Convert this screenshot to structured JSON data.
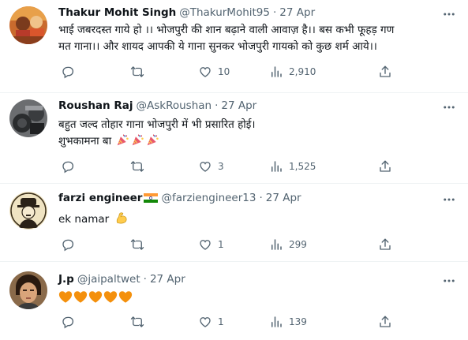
{
  "tweets": [
    {
      "name": "Thakur Mohit Singh",
      "handle": "@ThakurMohit95",
      "separator": "·",
      "time": "27 Apr",
      "text_lines": [
        "भाई जबरदस्त गाये हो ।। भोजपुरी की शान बढ़ाने वाली आवाज़ है।। बस कभी फूहड़ गण",
        "मत गाना।। और शायद आपकी ये गाना सुनकर भोजपुरी गायको को कुछ शर्म आये।।"
      ],
      "replies": "",
      "retweets": "",
      "likes": "10",
      "views": "2,910"
    },
    {
      "name": "Roushan Raj",
      "handle": "@AskRoushan",
      "separator": "·",
      "time": "27 Apr",
      "text_lines": [
        "बहुत जल्द तोहार गाना भोजपुरी में भी प्रसारित होई।",
        "शुभकामना बा"
      ],
      "emoji_icons": [
        "party-popper-icon",
        "party-popper-icon",
        "party-popper-icon"
      ],
      "replies": "",
      "retweets": "",
      "likes": "3",
      "views": "1,525"
    },
    {
      "name": "farzi engineer",
      "flag_icon": "india-flag-icon",
      "handle": "@farziengineer13",
      "separator": "·",
      "time": "27 Apr",
      "text_lines": [
        "ek namar"
      ],
      "emoji_icons": [
        "flexed-biceps-icon"
      ],
      "replies": "",
      "retweets": "",
      "likes": "1",
      "views": "299"
    },
    {
      "name": "J.p",
      "handle": "@jaipaltwet",
      "separator": "·",
      "time": "27 Apr",
      "text_lines": [
        ""
      ],
      "emoji_icons": [
        "orange-heart-icon",
        "orange-heart-icon",
        "orange-heart-icon",
        "orange-heart-icon",
        "orange-heart-icon"
      ],
      "replies": "",
      "retweets": "",
      "likes": "1",
      "views": "139"
    }
  ],
  "colors": {
    "text": "#0f1419",
    "secondary": "#536471",
    "divider": "#eff3f4",
    "emoji_orange": "#f4900c"
  }
}
